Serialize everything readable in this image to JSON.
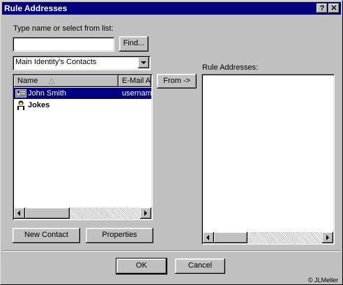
{
  "window": {
    "title": "Rule Addresses",
    "help_label": "?",
    "close_label": "✕"
  },
  "search": {
    "label": "Type name or select from list:",
    "value": "",
    "find_label": "Find..."
  },
  "source": {
    "selected": "Main Identity's Contacts"
  },
  "contacts": {
    "columns": {
      "name": "Name",
      "email": "E-Mail A"
    },
    "sort_indicator": "△",
    "rows": [
      {
        "name": "John Smith",
        "email": "usernam",
        "selected": true,
        "icon": "contact-card-icon"
      },
      {
        "name": "Jokes",
        "email": "",
        "selected": false,
        "icon": "group-icon"
      }
    ]
  },
  "from_label": "From ->",
  "rule_addresses": {
    "label": "Rule Addresses:",
    "items": []
  },
  "buttons": {
    "new_contact": "New Contact",
    "properties": "Properties",
    "ok": "OK",
    "cancel": "Cancel"
  },
  "watermark": "© JLMeller"
}
